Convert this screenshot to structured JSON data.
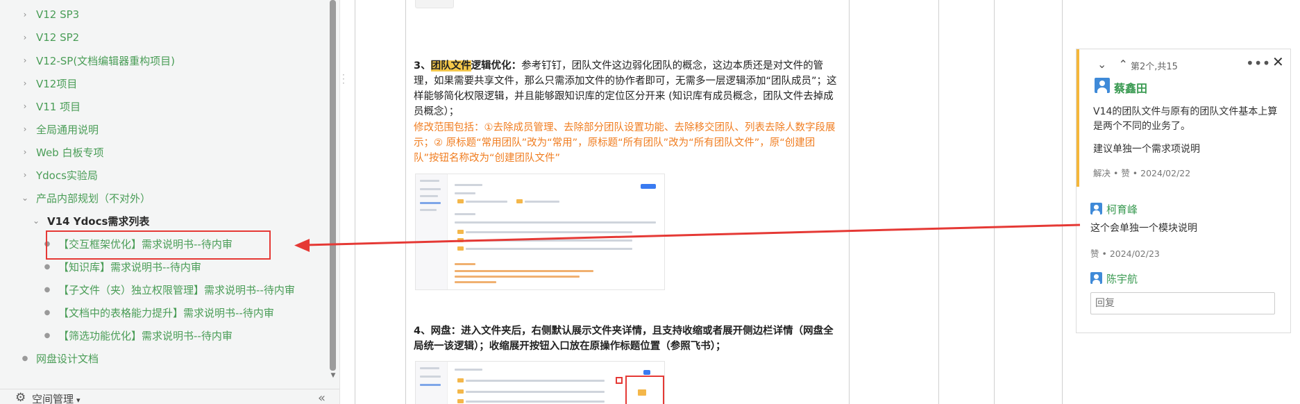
{
  "sidebar": {
    "items": [
      {
        "label": "V12 SP3",
        "marker": "chevron"
      },
      {
        "label": "V12 SP2",
        "marker": "chevron"
      },
      {
        "label": "V12-SP(文档编辑器重构项目)",
        "marker": "chevron"
      },
      {
        "label": "V12项目",
        "marker": "chevron"
      },
      {
        "label": "V11 项目",
        "marker": "chevron"
      },
      {
        "label": "全局通用说明",
        "marker": "chevron"
      },
      {
        "label": "Web 白板专项",
        "marker": "chevron"
      },
      {
        "label": "Ydocs实验局",
        "marker": "chevron"
      },
      {
        "label": "产品内部规划（不对外）",
        "marker": "chevron-down"
      },
      {
        "label": "V14 Ydocs需求列表",
        "marker": "chevron-down"
      },
      {
        "label": "【交互框架优化】需求说明书--待内审",
        "marker": "dot"
      },
      {
        "label": "【知识库】需求说明书--待内审",
        "marker": "dot"
      },
      {
        "label": "【子文件（夹）独立权限管理】需求说明书--待内审",
        "marker": "dot"
      },
      {
        "label": "【文档中的表格能力提升】需求说明书--待内审",
        "marker": "dot"
      },
      {
        "label": "【筛选功能优化】需求说明书--待内审",
        "marker": "dot"
      },
      {
        "label": "网盘设计文档",
        "marker": "dot"
      }
    ],
    "footer": {
      "space_label": "空间管理",
      "caret": "▾",
      "collapse_icon": "«"
    }
  },
  "document": {
    "p1_num": "3、",
    "p1_highlight": "团队文件",
    "p1_bold_rest": "逻辑优化：",
    "p1_text": "参考钉钉，团队文件这边弱化团队的概念，这边本质还是对文件的管理，如果需要共享文件，那么只需添加文件的协作者即可，无需多一层逻辑添加“团队成员”；这样能够简化权限逻辑，并且能够跟知识库的定位区分开来 (知识库有成员概念，团队文件去掉成员概念）；",
    "p1_orange": "修改范围包括：①去除成员管理、去除部分团队设置功能、去除移交团队、列表去除人数字段展示；② 原标题“常用团队”改为“常用”，原标题“所有团队”改为“所有团队文件”，原“创建团队”按钮名称改为“创建团队文件”",
    "p2_bold": "4、网盘：进入文件夹后，右侧默认展示文件夹详情，且支持收缩或者展开侧边栏详情（网盘全局统一该逻辑）；收缩展开按钮入口放在原操作标题位置（参照飞书）；"
  },
  "comments": {
    "nav_icons": "⌄ ⌃",
    "counter": "第2个,共15",
    "more_icon": "•••",
    "close_icon": "✕",
    "thread": [
      {
        "author": "蔡鑫田",
        "lines": [
          "V14的团队文件与原有的团队文件基本上算是两个不同的业务了。",
          "建议单独一个需求项说明"
        ],
        "meta": "解决 • 赞 • 2024/02/22"
      },
      {
        "author": "柯育峰",
        "lines": [
          "这个会单独一个模块说明"
        ],
        "meta": "赞 • 2024/02/23"
      },
      {
        "author": "陈宇航"
      }
    ],
    "reply_placeholder": "回复"
  },
  "colors": {
    "link_green": "#4a9d57",
    "highlight": "#f5c84a",
    "orange_text": "#f07d20",
    "annotation_red": "#e53935",
    "active_comment_bar": "#f5b73b"
  }
}
